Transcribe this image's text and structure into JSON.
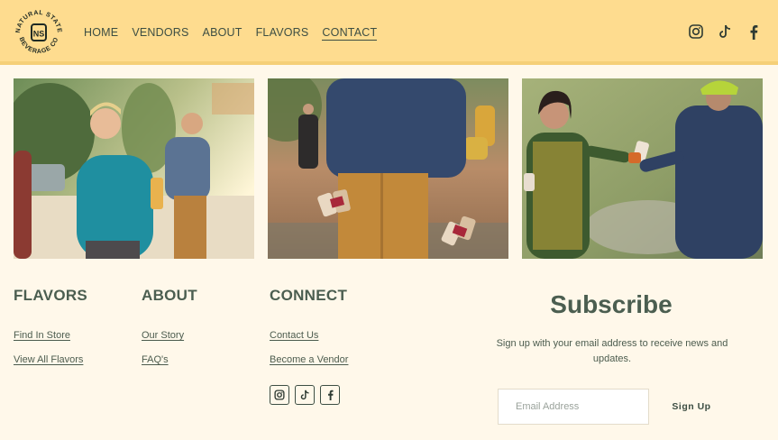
{
  "brand": {
    "logo_top_text": "NATURAL STATE",
    "logo_bottom_text": "BEVERAGE CO",
    "logo_monogram": "NS"
  },
  "nav": {
    "items": [
      {
        "label": "HOME",
        "active": false
      },
      {
        "label": "VENDORS",
        "active": false
      },
      {
        "label": "ABOUT",
        "active": false
      },
      {
        "label": "FLAVORS",
        "active": false
      },
      {
        "label": "CONTACT",
        "active": true
      }
    ]
  },
  "social": [
    "instagram-icon",
    "tiktok-icon",
    "facebook-icon"
  ],
  "photos": [
    {
      "name": "hikers-laughing-photo"
    },
    {
      "name": "man-holding-cans-photo"
    },
    {
      "name": "cheers-cans-photo"
    }
  ],
  "footer": {
    "flavors": {
      "heading": "FLAVORS",
      "links": [
        "Find In Store",
        "View All Flavors"
      ]
    },
    "about": {
      "heading": "ABOUT",
      "links": [
        "Our Story",
        "FAQ's"
      ]
    },
    "connect": {
      "heading": "CONNECT",
      "links": [
        "Contact Us",
        "Become a Vendor"
      ]
    }
  },
  "subscribe": {
    "title": "Subscribe",
    "text": "Sign up with your email address to receive news and updates.",
    "placeholder": "Email Address",
    "button_label": "Sign Up"
  },
  "colors": {
    "header_bg": "#fedc8f",
    "page_bg": "#fff8ea",
    "heading": "#4b5e50",
    "text": "#3d4e43"
  }
}
